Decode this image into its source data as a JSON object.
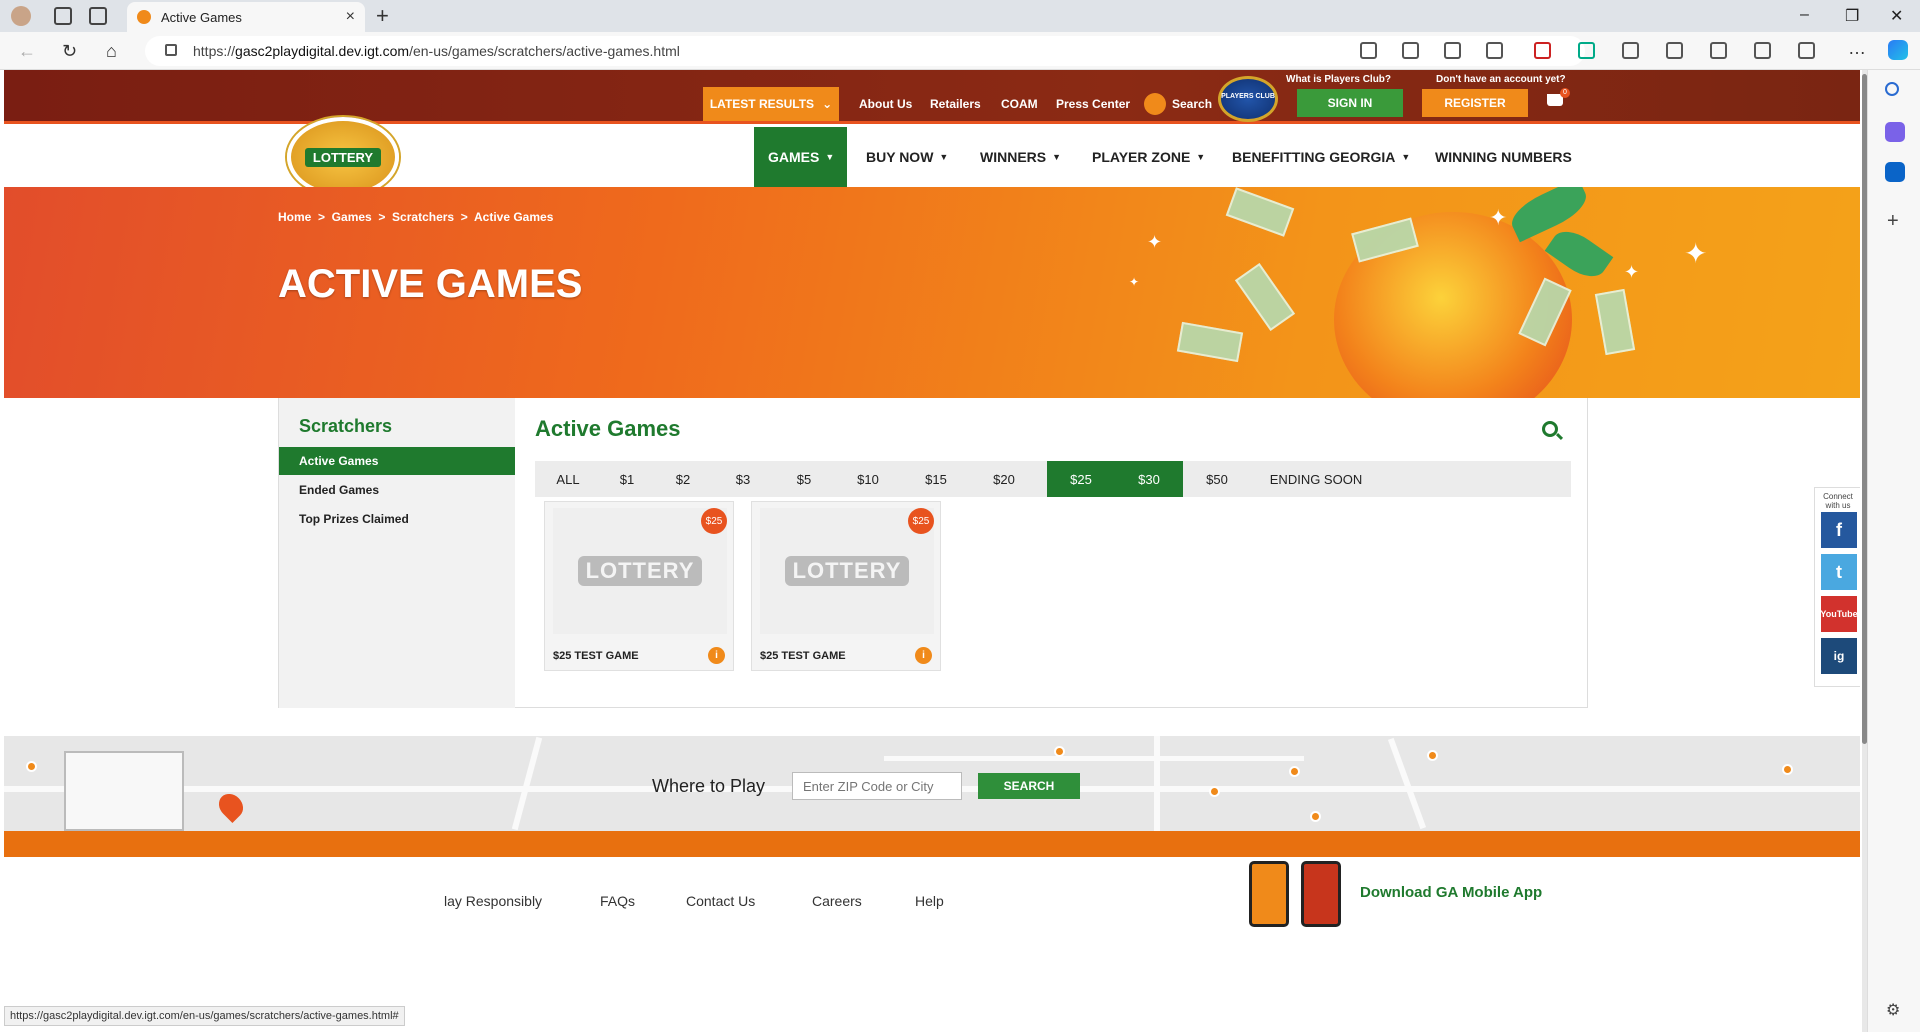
{
  "browser": {
    "tab_title": "Active Games",
    "url_prefix": "https://",
    "url_domain": "gasc2playdigital.dev.igt.com",
    "url_path": "/en-us/games/scratchers/active-games.html",
    "status_url": "https://gasc2playdigital.dev.igt.com/en-us/games/scratchers/active-games.html#"
  },
  "topbar": {
    "latest_results": "LATEST RESULTS",
    "links": [
      "About Us",
      "Retailers",
      "COAM",
      "Press Center"
    ],
    "search": "Search",
    "players_club_logo": "PLAYERS CLUB",
    "players_club_q": "What is Players Club?",
    "no_account_q": "Don't have an account yet?",
    "sign_in": "SIGN IN",
    "register": "REGISTER",
    "cart_count": "0"
  },
  "logo_text": "LOTTERY",
  "nav": {
    "items": [
      "GAMES",
      "BUY NOW",
      "WINNERS",
      "PLAYER ZONE",
      "BENEFITTING GEORGIA",
      "WINNING NUMBERS"
    ]
  },
  "hero": {
    "breadcrumb": "Home  >  Games  >  Scratchers  >  Active Games",
    "title": "ACTIVE GAMES"
  },
  "sidebar": {
    "title": "Scratchers",
    "items": [
      "Active Games",
      "Ended Games",
      "Top Prizes Claimed"
    ]
  },
  "main": {
    "title": "Active Games",
    "filters": [
      "ALL",
      "$1",
      "$2",
      "$3",
      "$5",
      "$10",
      "$15",
      "$20",
      "$25",
      "$30",
      "$50",
      "ENDING SOON"
    ],
    "selected_filters": [
      "$25",
      "$30"
    ],
    "games": [
      {
        "name": "$25 TEST GAME",
        "price": "$25",
        "placeholder": "LOTTERY"
      },
      {
        "name": "$25 TEST GAME",
        "price": "$25",
        "placeholder": "LOTTERY"
      }
    ]
  },
  "social": {
    "label": "Connect with us",
    "networks": [
      "f",
      "t",
      "YouTube",
      "ig"
    ]
  },
  "where_to_play": {
    "label": "Where to Play",
    "placeholder": "Enter ZIP Code or City",
    "button": "SEARCH"
  },
  "footer": {
    "links": [
      "lay Responsibly",
      "FAQs",
      "Contact Us",
      "Careers",
      "Help"
    ],
    "download": "Download GA Mobile App"
  },
  "colors": {
    "brand_green": "#1f7a2e",
    "brand_orange": "#f08a1a",
    "topbar_red": "#7a1e12"
  }
}
